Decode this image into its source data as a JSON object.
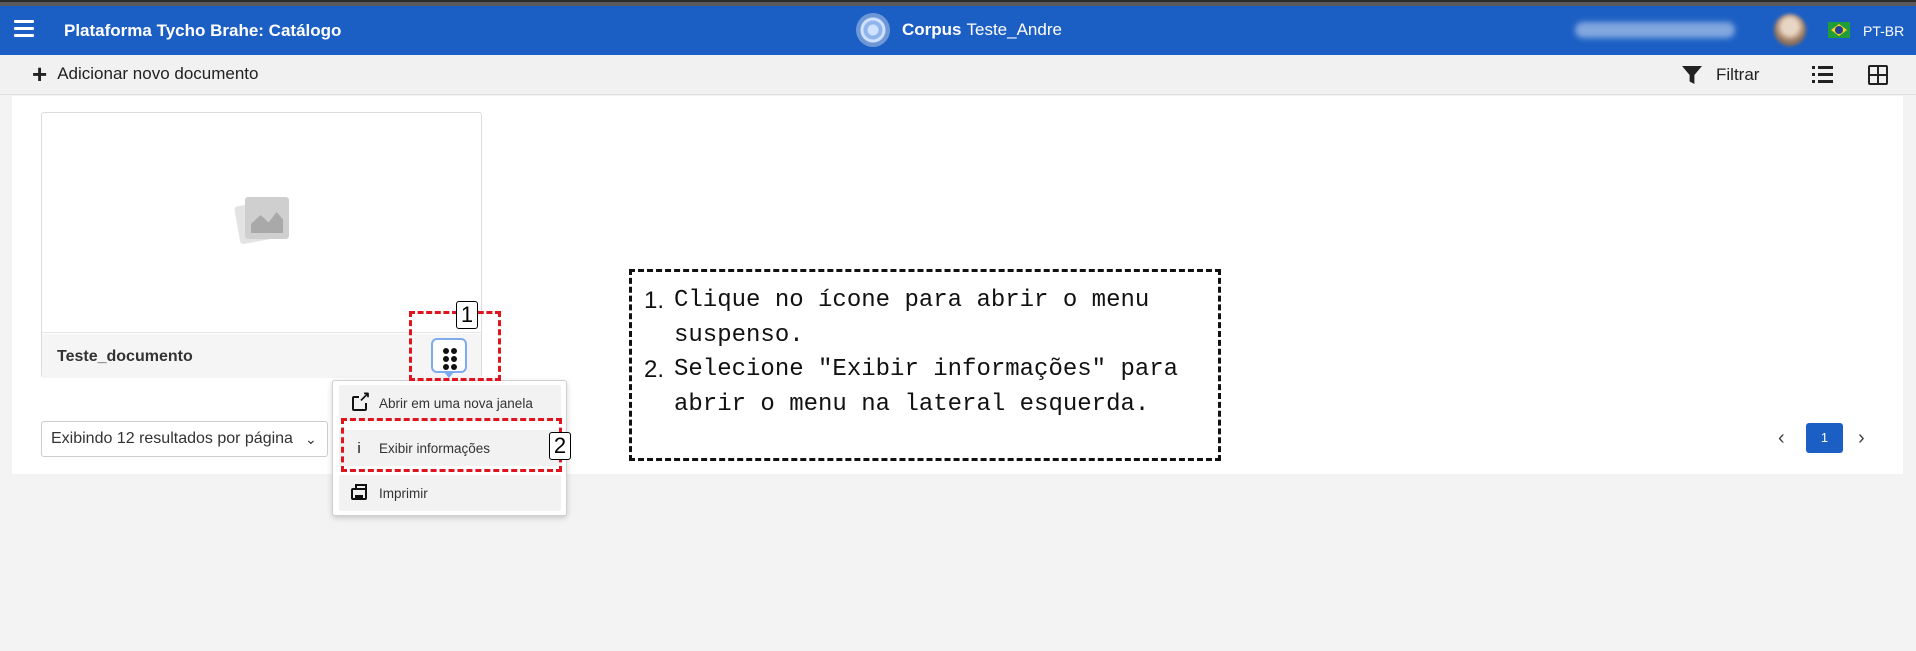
{
  "navbar": {
    "app_title": "Plataforma Tycho Brahe: Catálogo",
    "corpus_label": "Corpus",
    "corpus_name": "Teste_Andre",
    "language": "PT-BR"
  },
  "toolbar": {
    "add_label": "Adicionar novo documento",
    "filter_label": "Filtrar"
  },
  "documents": [
    {
      "title": "Teste_documento"
    }
  ],
  "context_menu": {
    "items": [
      {
        "label": "Abrir em uma nova janela",
        "icon": "external-link-icon"
      },
      {
        "label": "Exibir informações",
        "icon": "info-icon"
      },
      {
        "label": "Imprimir",
        "icon": "printer-icon"
      }
    ]
  },
  "pagination": {
    "per_page_label": "Exibindo 12 resultados por página",
    "current_page": "1"
  },
  "annotations": {
    "markers": [
      "1",
      "2"
    ],
    "steps": [
      {
        "number": "1.",
        "text": "Clique no ícone para abrir o menu suspenso."
      },
      {
        "number": "2.",
        "text": "Selecione \"Exibir informações\" para abrir o menu na lateral esquerda."
      }
    ],
    "highlight_color": "#e0141e"
  },
  "colors": {
    "brand": "#1c5fc4",
    "page_active": "#1c5fc4"
  }
}
